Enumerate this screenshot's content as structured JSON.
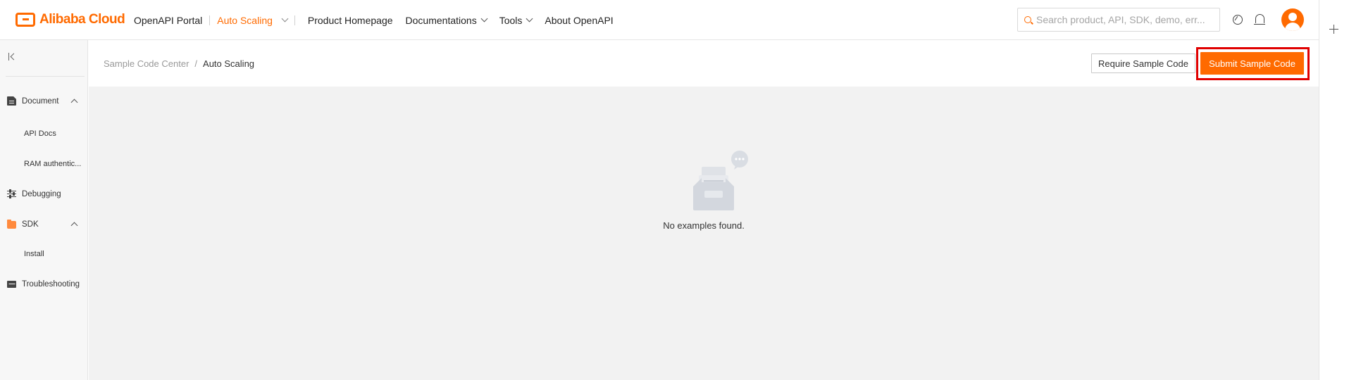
{
  "brand": {
    "logo_text": "Alibaba Cloud",
    "accent_color": "#ff6a00"
  },
  "nav": {
    "portal": "OpenAPI Portal",
    "product": "Auto Scaling",
    "items": [
      {
        "label": "Product Homepage",
        "has_dropdown": false
      },
      {
        "label": "Documentations",
        "has_dropdown": true
      },
      {
        "label": "Tools",
        "has_dropdown": true
      },
      {
        "label": "About OpenAPI",
        "has_dropdown": false
      }
    ]
  },
  "search": {
    "placeholder": "Search product, API, SDK, demo, err..."
  },
  "header_icons": [
    "globe-icon",
    "bell-icon",
    "avatar"
  ],
  "sidebar": {
    "sections": [
      {
        "label": "Document",
        "icon": "document-icon",
        "expanded": true,
        "children": [
          "API Docs",
          "RAM authentic..."
        ]
      },
      {
        "label": "Debugging",
        "icon": "debugging-icon"
      },
      {
        "label": "SDK",
        "icon": "sdk-folder-icon",
        "expanded": true,
        "children": [
          "Install"
        ]
      },
      {
        "label": "Troubleshooting",
        "icon": "troubleshooting-icon"
      }
    ]
  },
  "breadcrumb": {
    "parent": "Sample Code Center",
    "separator": "/",
    "current": "Auto Scaling"
  },
  "actions": {
    "require": "Require Sample Code",
    "submit": "Submit Sample Code"
  },
  "empty_state": {
    "message": "No examples found."
  }
}
